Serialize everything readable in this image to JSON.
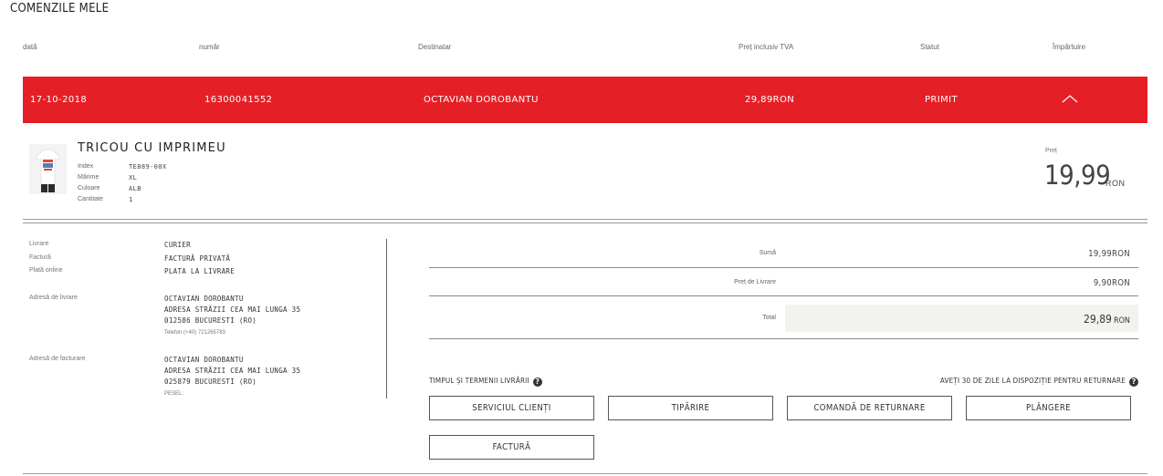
{
  "page_title": "COMENZILE MELE",
  "columns": {
    "date": "dată",
    "number": "număr",
    "recipient": "Destinatar",
    "price": "Preț inclusiv TVA",
    "status": "Statut",
    "share": "Împărtuire"
  },
  "order": {
    "date": "17-10-2018",
    "number": "16300041552",
    "recipient": "OCTAVIAN DOROBANTU",
    "price": "29,89RON",
    "status": "PRIMIT"
  },
  "product": {
    "title": "TRICOU CU IMPRIMEU",
    "attributes": [
      {
        "label": "Index",
        "value": "TE889-00X"
      },
      {
        "label": "Mărime",
        "value": "XL"
      },
      {
        "label": "Culoare",
        "value": "ALB"
      },
      {
        "label": "Cantitate",
        "value": "1"
      }
    ],
    "price_label": "Preț",
    "price": "19,99",
    "currency": "RON"
  },
  "info": {
    "delivery_label": "Livrare",
    "delivery_value": "CURIER",
    "invoice_label": "Factură",
    "invoice_value": "FACTURĂ PRIVATĂ",
    "payment_label": "Plată online",
    "payment_value": "PLATA LA LIVRARE",
    "shipping_address_label": "Adresă de livrare",
    "shipping_address": {
      "name": "OCTAVIAN DOROBANTU",
      "street": "ADRESA STRĂZII CEA MAI LUNGA 35",
      "city": "012586 BUCURESTI (RO)",
      "phone": "Telefon (+40) 721265783"
    },
    "billing_address_label": "Adresă de facturare",
    "billing_address": {
      "name": "OCTAVIAN DOROBANTU",
      "street": "ADRESA STRĂZII CEA MAI LUNGA 35",
      "city": "025879 BUCURESTI (RO)",
      "extra": "PESEL:"
    }
  },
  "summary": {
    "sum_label": "Sumă",
    "sum_value": "19,99RON",
    "shipping_label": "Preț de Livrare",
    "shipping_value": "9,90RON",
    "total_label": "Total",
    "total_value": "29,89",
    "total_currency": "RON"
  },
  "notes": {
    "delivery_terms": "TIMPUL ȘI TERMENII LIVRĂRII",
    "returns": "AVEȚI 30 DE ZILE LA DISPOZIȚIE PENTRU RETURNARE",
    "help_glyph": "?"
  },
  "buttons": {
    "customer_service": "SERVICIUL CLIENȚI",
    "print": "TIPĂRIRE",
    "return_order": "COMANDĂ DE RETURNARE",
    "complaint": "PLÂNGERE",
    "invoice": "FACTURĂ"
  },
  "colors": {
    "accent": "#e42026"
  }
}
